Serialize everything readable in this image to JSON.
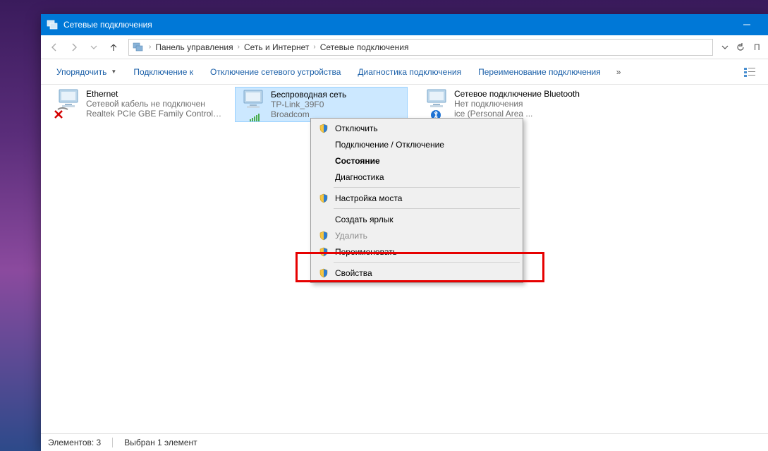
{
  "window_title": "Сетевые подключения",
  "breadcrumbs": [
    "Панель управления",
    "Сеть и Интернет",
    "Сетевые подключения"
  ],
  "toolbar": {
    "organize": "Упорядочить",
    "connect_to": "Подключение к",
    "disable": "Отключение сетевого устройства",
    "diagnose": "Диагностика подключения",
    "rename": "Переименование подключения"
  },
  "connections": {
    "ethernet": {
      "name": "Ethernet",
      "status": "Сетевой кабель не подключен",
      "device": "Realtek PCIe GBE Family Controller"
    },
    "wifi": {
      "name": "Беспроводная сеть",
      "status": "TP-Link_39F0",
      "device": "Broadcom"
    },
    "bluetooth": {
      "name": "Сетевое подключение Bluetooth",
      "status": "Нет подключения",
      "device_suffix": "ice (Personal Area ..."
    }
  },
  "context_menu": {
    "disable": "Отключить",
    "connect_disconnect": "Подключение / Отключение",
    "status": "Состояние",
    "diagnose": "Диагностика",
    "bridge": "Настройка моста",
    "shortcut": "Создать ярлык",
    "delete": "Удалить",
    "rename": "Переименовать",
    "properties": "Свойства"
  },
  "statusbar": {
    "items": "Элементов: 3",
    "selected": "Выбран 1 элемент"
  },
  "search_hint": "П"
}
